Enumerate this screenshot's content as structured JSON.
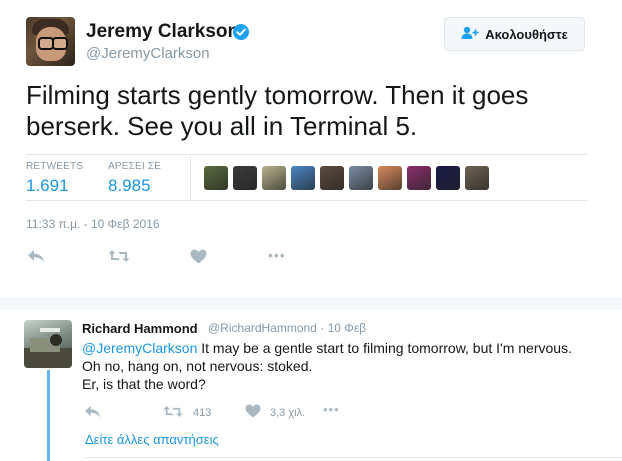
{
  "tweet": {
    "author_name": "Jeremy Clarkson",
    "author_handle": "@JeremyClarkson",
    "follow_label": "Ακολουθήστε",
    "text": "Filming starts gently tomorrow. Then it goes berserk. See you all in Terminal 5.",
    "stats": {
      "retweets_label": "RETWEETS",
      "retweets_value": "1.691",
      "likes_label": "ΑΡΕΣΕΙ ΣΕ",
      "likes_value": "8.985"
    },
    "likers": [
      {
        "name": "liker-avatar-1",
        "color": "#5a6b3c"
      },
      {
        "name": "liker-avatar-2",
        "color": "#3a3a3a"
      },
      {
        "name": "liker-avatar-3",
        "color": "#b9b48a"
      },
      {
        "name": "liker-avatar-4",
        "color": "#4a86c5"
      },
      {
        "name": "liker-avatar-5",
        "color": "#5d4a3c"
      },
      {
        "name": "liker-avatar-6",
        "color": "#7b8da3"
      },
      {
        "name": "liker-avatar-7",
        "color": "#d98a5c"
      },
      {
        "name": "liker-avatar-8",
        "color": "#8a2f6b"
      },
      {
        "name": "liker-avatar-9",
        "color": "#1a1a4a"
      },
      {
        "name": "liker-avatar-10",
        "color": "#6d6250"
      }
    ],
    "timestamp": "11:33 π.μ. - 10 Φεβ 2016",
    "more_icon": "•••"
  },
  "reply": {
    "author_name": "Richard Hammond",
    "author_handle": "@RichardHammond",
    "date": "· 10 Φεβ",
    "mention": "@JeremyClarkson",
    "text_line1": " It may be a gentle start to filming tomorrow, but I'm  nervous.",
    "text_line2": "Oh no, hang on, not nervous: stoked.",
    "text_line3": "Er, is that the word?",
    "retweet_count": "413",
    "like_count": "3,3 χιλ.",
    "more_icon": "•••",
    "more_replies_label": "Δείτε άλλες απαντήσεις"
  },
  "colors": {
    "accent": "#1da1f2",
    "link": "#1b95e0",
    "muted": "#8899a6",
    "icon": "#aab8c2",
    "thread": "#66b5f2"
  }
}
